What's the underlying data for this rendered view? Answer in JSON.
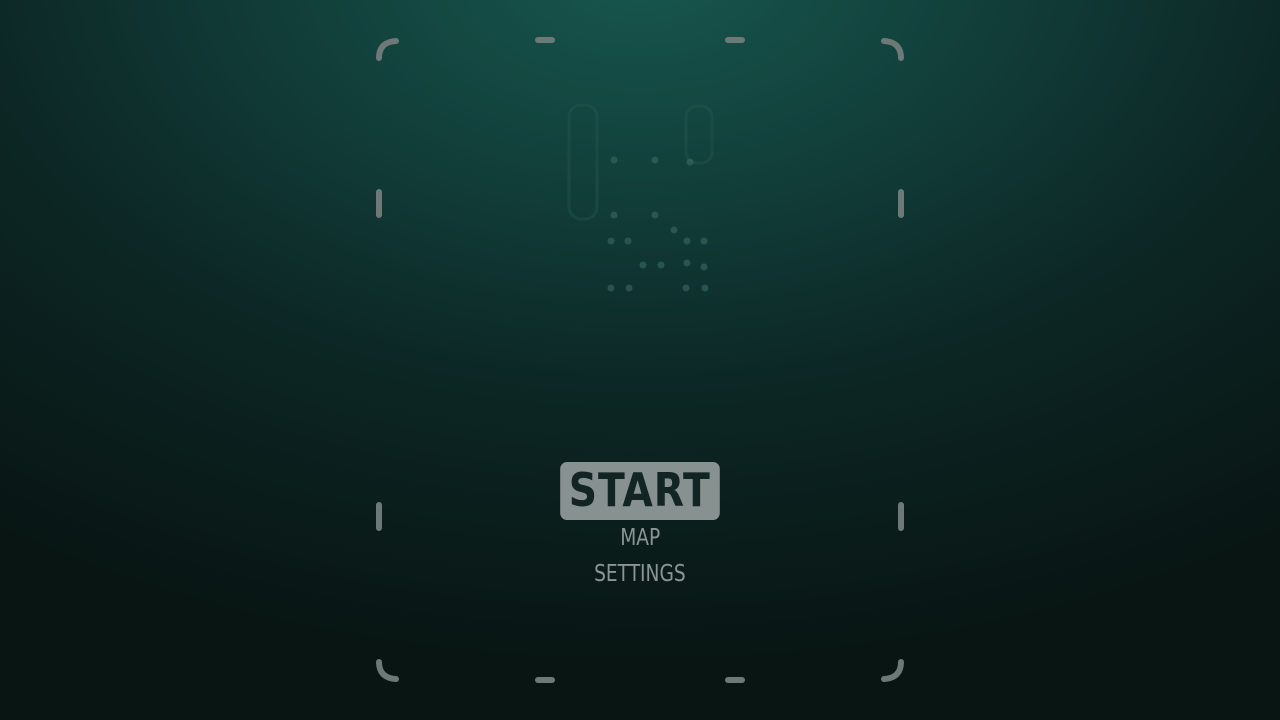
{
  "menu": {
    "items": [
      {
        "label": "START",
        "selected": true
      },
      {
        "label": "MAP",
        "selected": false
      },
      {
        "label": "SETTINGS",
        "selected": false
      }
    ]
  },
  "colors": {
    "background_top": "#17584f",
    "background_bottom": "#081513",
    "frame_marks": "#6d7977",
    "selected_bg": "#87918f",
    "selected_text": "#122523",
    "menu_text": "#8b9592"
  },
  "icons": {
    "frame_corner": "rounded-bracket",
    "logo": "faded-dot-pattern-logo"
  }
}
